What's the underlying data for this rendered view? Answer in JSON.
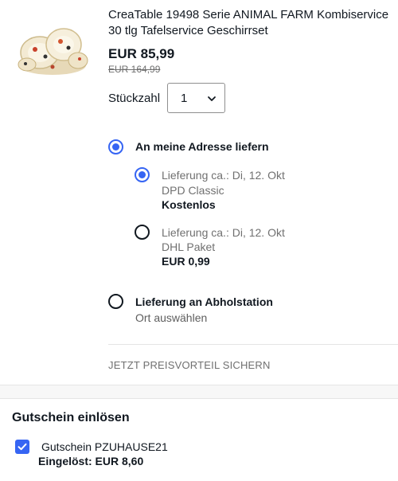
{
  "product": {
    "image_icon": "tableware-set-image",
    "title": "CreaTable 19498 Serie ANIMAL FARM Kombiservice 30 tlg Tafelservice Geschirrset",
    "price": "EUR 85,99",
    "old_price": "EUR 164,99"
  },
  "quantity": {
    "label": "Stückzahl",
    "value": "1",
    "icon": "chevron-down-icon"
  },
  "delivery": {
    "home": {
      "label": "An meine Adresse liefern",
      "selected": true,
      "options": [
        {
          "eta": "Lieferung ca.: Di, 12. Okt",
          "carrier": "DPD Classic",
          "cost": "Kostenlos",
          "selected": true
        },
        {
          "eta": "Lieferung ca.: Di, 12. Okt",
          "carrier": "DHL Paket",
          "cost": "EUR 0,99",
          "selected": false
        }
      ]
    },
    "pickup": {
      "label": "Lieferung an Abholstation",
      "sub": "Ort auswählen",
      "selected": false
    }
  },
  "promo": {
    "label": "JETZT PREISVORTEIL SICHERN"
  },
  "coupon": {
    "title": "Gutschein einlösen",
    "code": "Gutschein PZUHAUSE21",
    "redeemed": "Eingelöst: EUR 8,60",
    "checked": true
  },
  "colors": {
    "accent": "#3665f3",
    "text": "#111820",
    "muted": "#707070"
  }
}
